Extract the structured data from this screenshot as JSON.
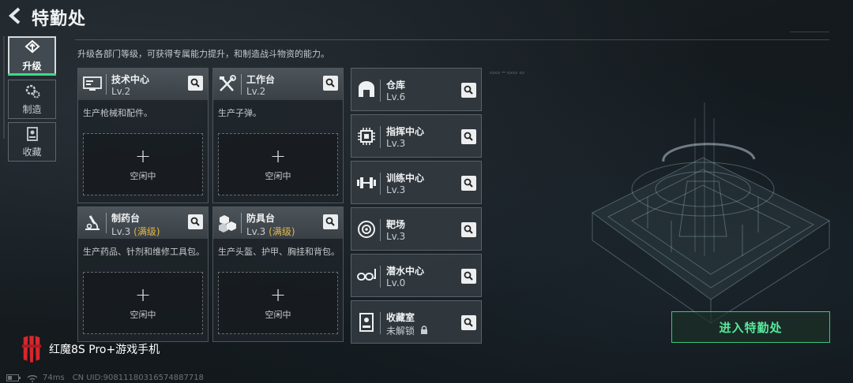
{
  "page": {
    "title": "特勤处"
  },
  "description": "升级各部门等级，可获得专属能力提升，和制造战斗物资的能力。",
  "tabs": [
    {
      "label": "升级",
      "icon": "upgrade-icon",
      "active": true
    },
    {
      "label": "制造",
      "icon": "gears-icon",
      "active": false
    },
    {
      "label": "收藏",
      "icon": "collection-icon",
      "active": false
    }
  ],
  "cards": [
    {
      "name": "技术中心",
      "level": "Lv.2",
      "max_tag": "",
      "icon": "computer-icon",
      "desc": "生产枪械和配件。",
      "slot": {
        "plus": "+",
        "label": "空闲中"
      }
    },
    {
      "name": "工作台",
      "level": "Lv.2",
      "max_tag": "",
      "icon": "tools-icon",
      "desc": "生产子弹。",
      "slot": {
        "plus": "+",
        "label": "空闲中"
      }
    },
    {
      "name": "制药台",
      "level": "Lv.3",
      "max_tag": "(满级)",
      "icon": "microscope-icon",
      "desc": "生产药品、针剂和维修工具包。",
      "slot": {
        "plus": "+",
        "label": "空闲中"
      }
    },
    {
      "name": "防具台",
      "level": "Lv.3",
      "max_tag": "(满级)",
      "icon": "armor-boxes-icon",
      "desc": "生产头盔、护甲、胸挂和背包。",
      "slot": {
        "plus": "+",
        "label": "空闲中"
      }
    }
  ],
  "rows": [
    {
      "name": "仓库",
      "level": "Lv.6",
      "icon": "warehouse-icon"
    },
    {
      "name": "指挥中心",
      "level": "Lv.3",
      "icon": "chip-icon"
    },
    {
      "name": "训练中心",
      "level": "Lv.3",
      "icon": "dumbbell-icon"
    },
    {
      "name": "靶场",
      "level": "Lv.3",
      "icon": "target-icon"
    },
    {
      "name": "潜水中心",
      "level": "Lv.0",
      "icon": "diving-mask-icon"
    },
    {
      "name": "收藏室",
      "level": "未解锁",
      "icon": "display-case-icon",
      "locked": true
    }
  ],
  "enter_button": "进入特勤处",
  "watermark": "红魔8S Pro+游戏手机",
  "footer": {
    "ping": "74ms",
    "uid": "CN UID:9081118031657488​7718"
  },
  "colors": {
    "accent_green": "#3fd98a",
    "max_level_gold": "#e2b84a"
  }
}
